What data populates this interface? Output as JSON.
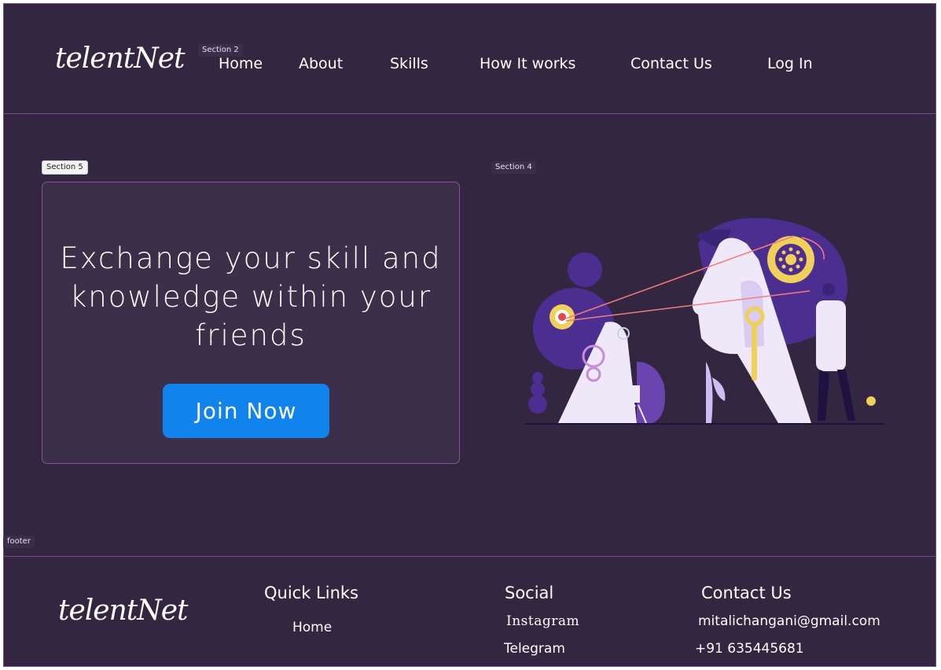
{
  "brand": {
    "logo_text": "telentNet"
  },
  "nav": {
    "home": "Home",
    "about": "About",
    "skills": "Skills",
    "how_it_works": "How It works",
    "contact": "Contact Us",
    "login": "Log In"
  },
  "design_tags": {
    "section2": "Section 2",
    "section5": "Section 5",
    "section4": "Section 4",
    "footer": "footer"
  },
  "hero": {
    "headline": "Exchange your skill and knowledge within your friends",
    "cta_label": "Join Now"
  },
  "illustration": {
    "icon": "people-exchanging-ideas-gears-illustration"
  },
  "footer": {
    "logo_text": "telentNet",
    "quick_links": {
      "title": "Quick Links",
      "items": [
        "Home"
      ]
    },
    "social": {
      "title": "Social",
      "items": [
        "Instagram",
        "Telegram"
      ]
    },
    "contact": {
      "title": "Contact Us",
      "email": "mitalichangani@gmail.com",
      "phone": "+91 635445681"
    }
  },
  "colors": {
    "background": "#332640",
    "card": "#3c2f4a",
    "accent": "#1183ec",
    "border": "#7a4a8a",
    "illustration_purple": "#4b2e8f",
    "illustration_yellow": "#f0cf5a"
  }
}
